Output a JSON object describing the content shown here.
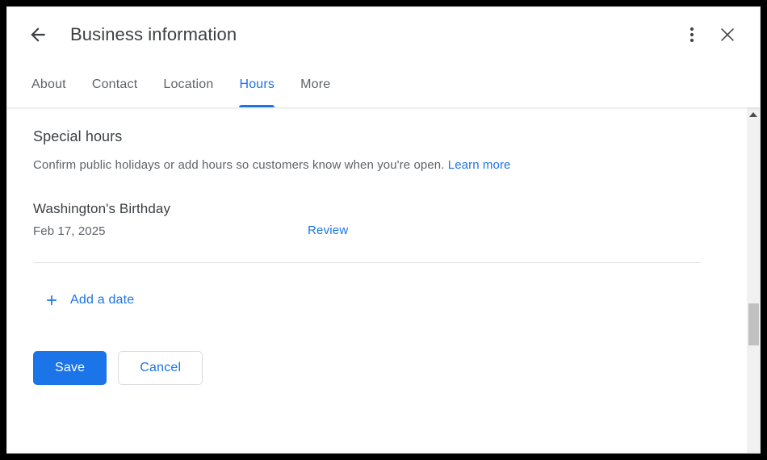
{
  "window": {
    "title": "Business information",
    "back_icon": "back-arrow-icon",
    "overflow_icon": "more-vert-icon",
    "close_icon": "close-icon"
  },
  "tabs": [
    {
      "label": "About",
      "active": false
    },
    {
      "label": "Contact",
      "active": false
    },
    {
      "label": "Location",
      "active": false
    },
    {
      "label": "Hours",
      "active": true
    },
    {
      "label": "More",
      "active": false
    }
  ],
  "main": {
    "section_title": "Special hours",
    "description": "Confirm public holidays or add hours so customers know when you're open.",
    "learn_more": "Learn more",
    "holiday": {
      "name": "Washington's Birthday",
      "date": "Feb 17, 2025",
      "action": "Review"
    },
    "add_date": {
      "icon": "plus-icon",
      "label": "Add a date"
    },
    "save_label": "Save",
    "cancel_label": "Cancel"
  },
  "scrollbar": {
    "up_arrow_icon": "caret-up-icon",
    "down_arrow_icon": "caret-down-icon"
  },
  "colors": {
    "accent": "#1b74e8",
    "text_primary": "#3c4043",
    "text_secondary": "#5f6368",
    "divider": "#e0e0e0",
    "scroll_thumb": "#c1c1c1"
  }
}
